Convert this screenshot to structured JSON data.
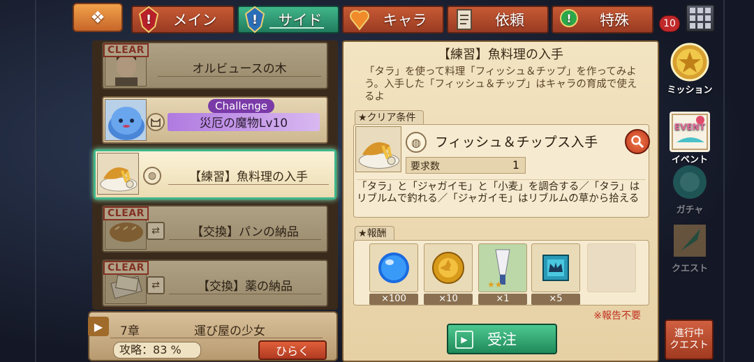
{
  "tabs": [
    {
      "label": "メイン",
      "active": false,
      "icon": "alert-icon"
    },
    {
      "label": "サイド",
      "active": true,
      "icon": "alert-icon"
    },
    {
      "label": "キャラ",
      "active": false,
      "icon": "heart-icon"
    },
    {
      "label": "依頼",
      "active": false,
      "icon": "document-icon"
    },
    {
      "label": "特殊",
      "active": false,
      "icon": "alert-icon"
    }
  ],
  "notification_count": "10",
  "quest_list": [
    {
      "title": "オルビュースの木",
      "cleared": true,
      "thumb": "man-portrait"
    },
    {
      "title": "災厄の魔物Lv10",
      "cleared": false,
      "challenge": true,
      "thumb": "blue-slime"
    },
    {
      "title": "【練習】魚料理の入手",
      "cleared": false,
      "selected": true,
      "thumb": "fish-and-chips"
    },
    {
      "title": "【交換】パンの納品",
      "cleared": true,
      "thumb": "bread"
    },
    {
      "title": "【交換】薬の納品",
      "cleared": true,
      "thumb": "medicine"
    }
  ],
  "clear_label": "CLEAR",
  "challenge_label": "Challenge",
  "chapter": {
    "number": "7章",
    "name": "運び屋の少女",
    "progress_label": "攻略：",
    "progress_value": "83 %",
    "open_label": "ひらく"
  },
  "detail": {
    "title": "【練習】魚料理の入手",
    "description": "「タラ」を使って料理「フィッシュ＆チップ」を作ってみよう。入手した「フィッシュ＆チップ」はキャラの育成で使えるよ",
    "clear_condition_label": "クリア条件",
    "condition_text": "フィッシュ＆チップス入手",
    "required_label": "要求数",
    "required_value": "1",
    "hint": "「タラ」と「ジャガイモ」と「小麦」を調合する／「タラ」はリブルムで釣れる／「ジャガイモ」はリブルムの草から拾える",
    "reward_label": "報酬",
    "rewards": [
      {
        "qty": "×100",
        "icon": "blue-orb-icon"
      },
      {
        "qty": "×10",
        "icon": "gold-coin-icon"
      },
      {
        "qty": "×1",
        "icon": "feather-weapon-icon"
      },
      {
        "qty": "×5",
        "icon": "crown-card-icon"
      }
    ],
    "note": "※報告不要",
    "accept_label": "受注"
  },
  "sidebar": [
    {
      "label": "ミッション",
      "icon": "medal-icon"
    },
    {
      "label": "イベント",
      "icon": "event-icon"
    },
    {
      "label": "ガチャ",
      "icon": "gacha-icon",
      "dim": true
    },
    {
      "label": "クエスト",
      "icon": "quill-icon",
      "dim": true
    }
  ],
  "progress_quest_label_1": "進行中",
  "progress_quest_label_2": "クエスト",
  "colors": {
    "active_tab": "#41b68a",
    "inactive_tab": "#c65a34",
    "clear_red": "#c43a2a",
    "accept_green": "#1f8a5a"
  }
}
